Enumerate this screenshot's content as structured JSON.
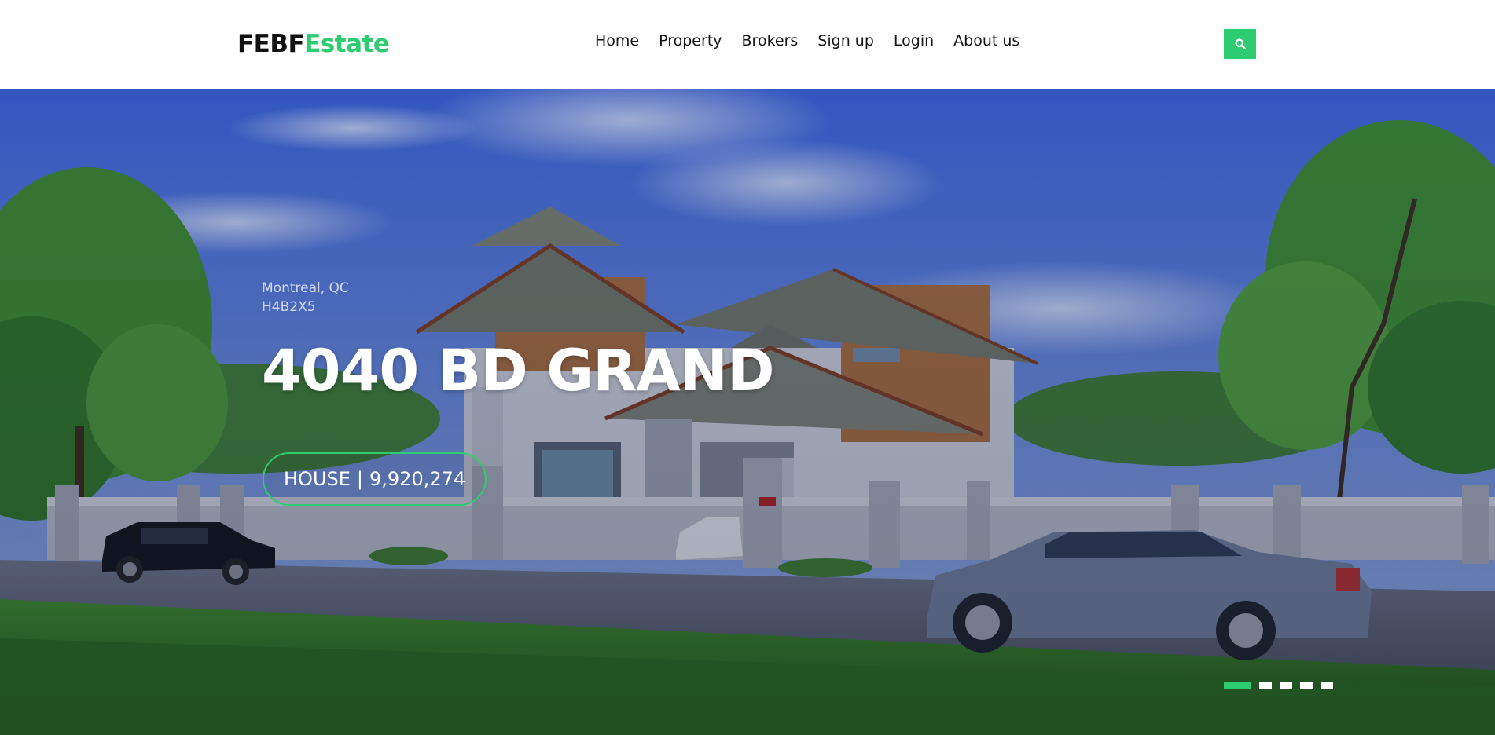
{
  "brand": {
    "name_dark": "FEBF",
    "name_accent": "Estate",
    "accent_color": "#2ecc71"
  },
  "nav": {
    "items": [
      {
        "label": "Home"
      },
      {
        "label": "Property"
      },
      {
        "label": "Brokers"
      },
      {
        "label": "Sign up"
      },
      {
        "label": "Login"
      },
      {
        "label": "About us"
      }
    ],
    "search_icon": "search-icon"
  },
  "hero": {
    "city": "Montreal, QC",
    "postal_code": "H4B2X5",
    "title": "4040 BD GRAND",
    "property_type": "HOUSE",
    "separator": "|",
    "price": "9,920,274",
    "slides_total": 5,
    "active_slide": 1
  }
}
